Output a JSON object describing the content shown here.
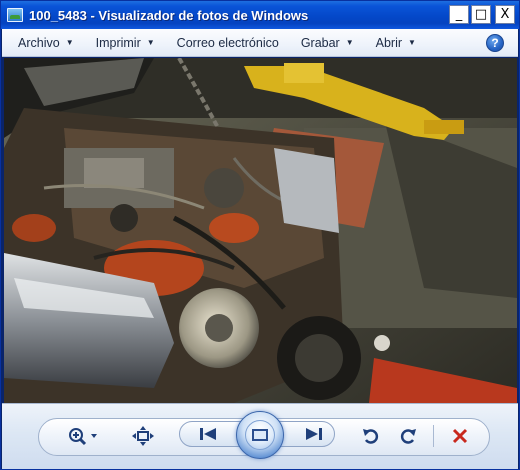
{
  "window": {
    "title": "100_5483 - Visualizador de fotos de Windows",
    "minimize_glyph": "_",
    "maximize_glyph": "□",
    "close_glyph": "X"
  },
  "menu": {
    "items": [
      {
        "label": "Archivo",
        "has_caret": true
      },
      {
        "label": "Imprimir",
        "has_caret": true
      },
      {
        "label": "Correo electrónico",
        "has_caret": false
      },
      {
        "label": "Grabar",
        "has_caret": true
      },
      {
        "label": "Abrir",
        "has_caret": true
      }
    ],
    "help_glyph": "?"
  },
  "photo": {
    "description_icon": "photo-engine-bay"
  },
  "toolbar": {
    "zoom_icon": "zoom-icon",
    "fit_icon": "actual-size-icon",
    "previous_icon": "previous-icon",
    "slideshow_icon": "slideshow-icon",
    "next_icon": "next-icon",
    "rotate_ccw_icon": "rotate-counterclockwise-icon",
    "rotate_cw_icon": "rotate-clockwise-icon",
    "delete_icon": "delete-icon"
  },
  "colors": {
    "title_bar": "#0a54d8",
    "delete_red": "#c8281e",
    "icon_blue": "#1f3f7a"
  }
}
